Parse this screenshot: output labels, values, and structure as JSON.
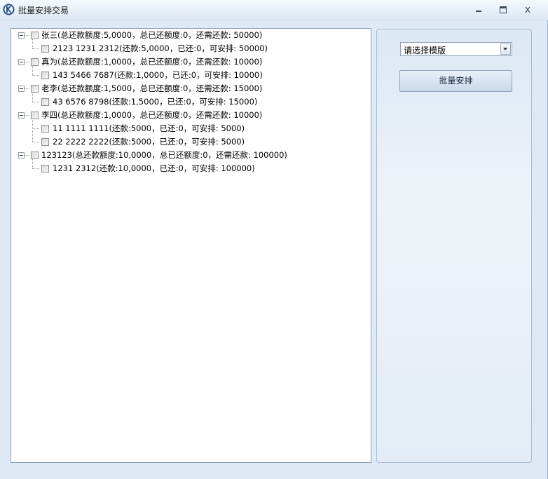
{
  "window": {
    "title": "批量安排交易",
    "minimize_glyph": "_",
    "close_glyph": "x",
    "icon": "app-logo-icon"
  },
  "tree": {
    "nodes": [
      {
        "label": "张三(总还款额度:5,0000，总已还额度:0，还需还款: 50000)",
        "children": [
          {
            "label": "2123  1231  2312(还款:5,0000，已还:0，可安排: 50000)"
          }
        ]
      },
      {
        "label": "真为(总还款额度:1,0000，总已还额度:0，还需还款: 10000)",
        "children": [
          {
            "label": "143  5466  7687(还款:1,0000，已还:0，可安排: 10000)"
          }
        ]
      },
      {
        "label": "老李(总还款额度:1,5000，总已还额度:0，还需还款: 15000)",
        "children": [
          {
            "label": "43  6576  8798(还款:1,5000，已还:0，可安排: 15000)"
          }
        ]
      },
      {
        "label": "李四(总还款额度:1,0000，总已还额度:0，还需还款: 10000)",
        "children": [
          {
            "label": "11  1111  1111(还款:5000，已还:0，可安排: 5000)"
          },
          {
            "label": "22  2222  2222(还款:5000，已还:0，可安排: 5000)"
          }
        ]
      },
      {
        "label": "123123(总还款额度:10,0000，总已还额度:0，还需还款: 100000)",
        "children": [
          {
            "label": "1231  2312(还款:10,0000，已还:0，可安排: 100000)"
          }
        ]
      }
    ]
  },
  "controls": {
    "template_select_value": "请选择模版",
    "batch_button_label": "批量安排"
  }
}
